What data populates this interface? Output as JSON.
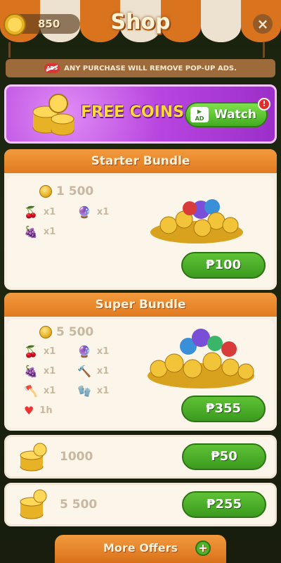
{
  "header": {
    "coins": "850",
    "title": "Shop",
    "close_symbol": "×"
  },
  "notice": {
    "ads_icon_text": "ADS",
    "text": "ANY PURCHASE WILL REMOVE POP-UP ADS."
  },
  "free_coins": {
    "label": "FREE COINS",
    "ad_badge": "AD",
    "watch_label": "Watch",
    "alert": "!"
  },
  "starter_bundle": {
    "title": "Starter Bundle",
    "coins": "1 500",
    "items": [
      {
        "icon": "fruit-booster-icon",
        "qty": "x1"
      },
      {
        "icon": "rainbow-ball-icon",
        "qty": "x1"
      },
      {
        "icon": "grape-booster-icon",
        "qty": "x1"
      }
    ],
    "price": "₱100"
  },
  "super_bundle": {
    "title": "Super Bundle",
    "coins": "5 500",
    "items": [
      {
        "icon": "fruit-booster-icon",
        "qty": "x1"
      },
      {
        "icon": "rainbow-ball-icon",
        "qty": "x1"
      },
      {
        "icon": "grape-booster-icon",
        "qty": "x1"
      },
      {
        "icon": "hammer-icon",
        "qty": "x1"
      },
      {
        "icon": "axe-icon",
        "qty": "x1"
      },
      {
        "icon": "glove-icon",
        "qty": "x1"
      },
      {
        "icon": "infinite-heart-icon",
        "qty": "1h"
      }
    ],
    "price": "₱355"
  },
  "coin_packs": [
    {
      "coins": "1000",
      "price": "₱50"
    },
    {
      "coins": "5 500",
      "price": "₱255"
    }
  ],
  "more_offers": {
    "label": "More Offers",
    "plus": "+"
  },
  "colors": {
    "orange": "#e07a1f",
    "green": "#43ac22",
    "purple": "#b845df",
    "gold": "#ffd93a"
  }
}
